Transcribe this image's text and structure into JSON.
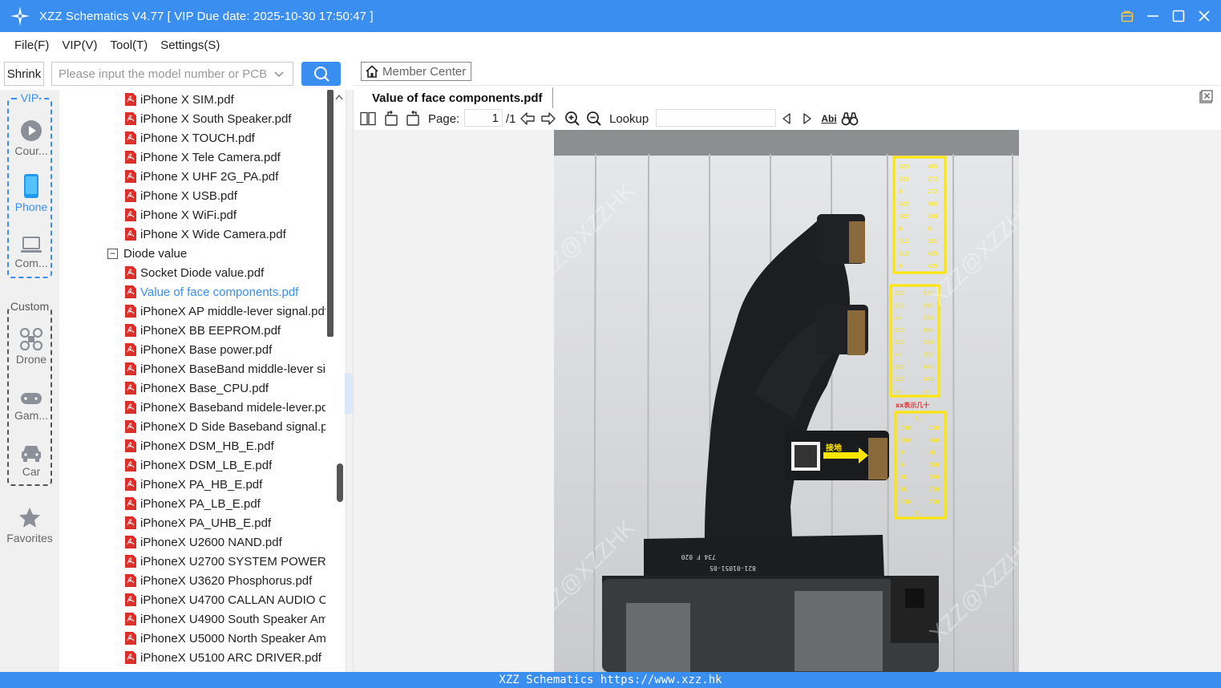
{
  "window": {
    "title": "XZZ Schematics V4.77 [ VIP Due date: 2025-10-30 17:50:47 ]"
  },
  "menu": [
    "File(F)",
    "VIP(V)",
    "Tool(T)",
    "Settings(S)"
  ],
  "search": {
    "shrink_label": "Shrink",
    "placeholder": "Please input the model number or PCB"
  },
  "rail": {
    "vip_label": "VIP",
    "custom_label": "Custom",
    "items": [
      "Cour...",
      "Phone",
      "Com...",
      "Drone",
      "Gam...",
      "Car",
      "Favorites"
    ]
  },
  "tree": {
    "files_top": [
      "iPhone X SIM.pdf",
      "iPhone X South Speaker.pdf",
      "iPhone X TOUCH.pdf",
      "iPhone X Tele Camera.pdf",
      "iPhone X UHF 2G_PA.pdf",
      "iPhone X USB.pdf",
      "iPhone X WiFi.pdf",
      "iPhone X Wide Camera.pdf"
    ],
    "folder": "Diode value",
    "files_folder": [
      "Socket Diode value.pdf",
      "Value of face components.pdf",
      "iPhoneX AP middle-lever signal.pdf",
      "iPhoneX BB EEPROM.pdf",
      "iPhoneX Base power.pdf",
      "iPhoneX BaseBand middle-lever si",
      "iPhoneX Base_CPU.pdf",
      "iPhoneX Baseband midele-lever.pdf",
      "iPhoneX D Side Baseband signal.pdf",
      "iPhoneX DSM_HB_E.pdf",
      "iPhoneX DSM_LB_E.pdf",
      "iPhoneX PA_HB_E.pdf",
      "iPhoneX PA_LB_E.pdf",
      "iPhoneX PA_UHB_E.pdf",
      "iPhoneX U2600 NAND.pdf",
      "iPhoneX U2700 SYSTEM POWER PMU",
      "iPhoneX U3620 Phosphorus.pdf",
      "iPhoneX U4700 CALLAN AUDIO CODEC",
      "iPhoneX U4900 South Speaker Amp",
      "iPhoneX U5000 North Speaker Amp",
      "iPhoneX U5100 ARC DRIVER.pdf"
    ]
  },
  "viewer": {
    "member_center": "Member Center",
    "tab_title": "Value of face components.pdf",
    "page_label": "Page:",
    "page_current": "1",
    "page_total": "/1",
    "lookup_label": "Lookup",
    "abi_label": "Abi"
  },
  "document": {
    "watermark": "XZZ@XZZHK",
    "table1": [
      [
        "323",
        "465"
      ],
      [
        "323",
        "272"
      ],
      [
        "0",
        "272"
      ],
      [
        "322",
        "465"
      ],
      [
        "322",
        "338"
      ],
      [
        "0",
        "0"
      ],
      [
        "312",
        "331"
      ],
      [
        "312",
        "425"
      ],
      [
        "0",
        "425"
      ]
    ],
    "table2": [
      [
        "225",
        "535"
      ],
      [
        "225",
        "540"
      ],
      [
        "xx",
        "531"
      ],
      [
        "225",
        "480"
      ],
      [
        "225",
        "531"
      ],
      [
        "xx",
        "397"
      ],
      [
        "225",
        "443"
      ],
      [
        "225",
        "443"
      ],
      [
        "xx",
        "xx"
      ]
    ],
    "note": "xx表示几十",
    "table3_head": "OL",
    "table3": [
      [
        "730",
        "730"
      ],
      [
        "550",
        "460"
      ],
      [
        "0",
        "OL"
      ],
      [
        "0",
        "550"
      ],
      [
        "OL",
        "550"
      ],
      [
        "OL",
        "730"
      ],
      [
        "730",
        "730"
      ]
    ],
    "table3_foot": "OL",
    "ground_label": "接地",
    "part_text": "821-01051-05",
    "part_text2": "734 F 020"
  },
  "status": {
    "text": "XZZ Schematics https://www.xzz.hk"
  }
}
